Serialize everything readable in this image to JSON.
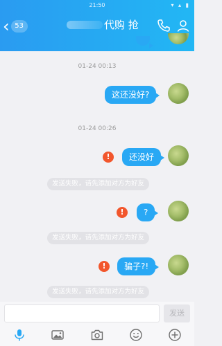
{
  "status_bar": {
    "time": "21:50",
    "icons": "▾ ▴ ▮"
  },
  "header": {
    "back_icon": "chevron-left-icon",
    "unread_count": "53",
    "title": "代购 抢",
    "call_icon": "phone-icon",
    "profile_icon": "person-icon",
    "background_color": "#2aa6f3"
  },
  "messages": {
    "timestamp_1": "01-24 00:13",
    "message_1": "这还没好?",
    "timestamp_2": "01-24 00:26",
    "message_2": "还没好",
    "message_3": "?",
    "message_4": "骗子?!",
    "failure_notice": "发送失败，请先添加对方为好友",
    "failure_icon_text": "!",
    "bubble_color": "#29a8f4",
    "failure_color": "#f2562c"
  },
  "input": {
    "value": "",
    "send_label": "发送"
  },
  "toolbar": {
    "icons": [
      "microphone-icon",
      "image-icon",
      "camera-icon",
      "emoji-icon",
      "plus-icon"
    ]
  }
}
